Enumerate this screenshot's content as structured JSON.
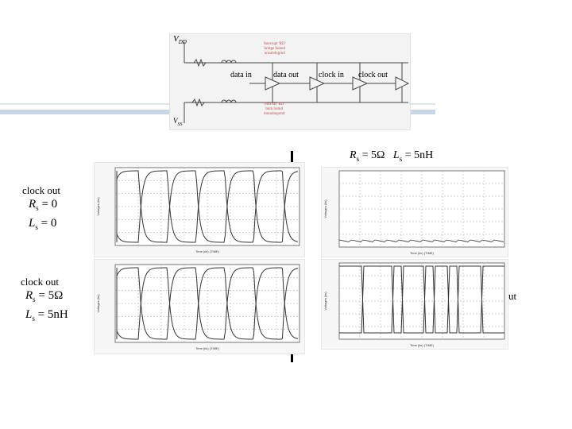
{
  "schematic": {
    "vdd_label": "V",
    "vdd_sub": "DD",
    "vss_label": "V",
    "vss_sub": "SS",
    "signals": [
      "data in",
      "data out",
      "clock in",
      "clock out"
    ],
    "note_top": [
      "Interrupt 'RD'",
      "bridge bonnd",
      "unsubdogrod"
    ],
    "note_bottom": [
      "Nod car 'RD'",
      "bntn bomd",
      "mnnubnpond"
    ]
  },
  "top_caption": {
    "r_symbol": "R",
    "r_sub": "s",
    "r_value": "= 5Ω",
    "l_symbol": "L",
    "l_sub": "s",
    "l_value": "= 5nH"
  },
  "left_captions": [
    {
      "title": "clock out",
      "r_symbol": "R",
      "r_sub": "s",
      "r_value": "= 0",
      "l_symbol": "L",
      "l_sub": "s",
      "l_value": "= 0"
    },
    {
      "title": "clock out",
      "r_symbol": "R",
      "r_sub": "s",
      "r_value": "= 5Ω",
      "l_symbol": "L",
      "l_sub": "s",
      "l_value": "= 5nH"
    }
  ],
  "right_edge_text": "ut",
  "plot_axis_labels": {
    "left_y": "Voltages (lin)",
    "left_x": "Time (lin) (TIME)",
    "right_y": "Voltages (lin)",
    "right_x": "Time (lin) (TIME)"
  },
  "colors": {
    "accent_bar": "#c9d6e6",
    "note": "#c0504d",
    "trace": "#333333"
  }
}
